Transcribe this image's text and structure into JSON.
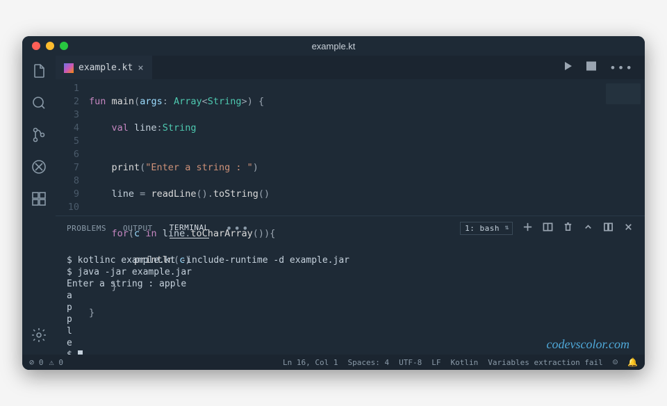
{
  "window": {
    "title": "example.kt"
  },
  "tab": {
    "filename": "example.kt"
  },
  "editor": {
    "gutter": [
      "1",
      "2",
      "3",
      "4",
      "5",
      "6",
      "7",
      "8",
      "9",
      "10"
    ],
    "l1": {
      "kw1": "fun",
      "fn": "main",
      "p1": "(",
      "arg": "args",
      "colon": ":",
      "sp": " ",
      "type1": "Array",
      "lt": "<",
      "type2": "String",
      "gt": ">",
      "p2": ")",
      "sp2": " ",
      "brace": "{"
    },
    "l2": {
      "indent": "    ",
      "kw": "val",
      "name": " line",
      "colon": ":",
      "type": "String"
    },
    "l3": "",
    "l4": {
      "indent": "    ",
      "fn": "print",
      "p1": "(",
      "str": "\"Enter a string : \"",
      "p2": ")"
    },
    "l5": {
      "indent": "    ",
      "lhs": "line ",
      "eq": "=",
      "sp": " ",
      "fn1": "readLine",
      "p1": "()",
      "dot": ".",
      "fn2": "toString",
      "p2": "()"
    },
    "l6": "",
    "l7": {
      "indent": "    ",
      "kw1": "for",
      "p1": "(",
      "v": "c",
      "sp1": " ",
      "kw2": "in",
      "sp2": " ",
      "obj": "line",
      "dot": ".",
      "fn": "toCharArray",
      "p2": "()",
      "p3": ")",
      "brace": "{"
    },
    "l8": {
      "indent": "        ",
      "fn": "println",
      "p1": "(",
      "v": "c",
      "p2": ")"
    },
    "l9": {
      "indent": "    ",
      "brace": "}"
    },
    "l10": {
      "brace": "}"
    }
  },
  "panel": {
    "tabs": {
      "problems": "PROBLEMS",
      "output": "OUTPUT",
      "terminal": "TERMINAL"
    },
    "more": "•••",
    "selector": "1: bash"
  },
  "terminal": {
    "lines": [
      "$ kotlinc example.kt -include-runtime -d example.jar",
      "$ java -jar example.jar",
      "Enter a string : apple",
      "a",
      "p",
      "p",
      "l",
      "e",
      "$ "
    ]
  },
  "watermark": "codevscolor.com",
  "statusbar": {
    "errors": "0",
    "warnings": "0",
    "lncol": "Ln 16, Col 1",
    "spaces": "Spaces: 4",
    "encoding": "UTF-8",
    "eol": "LF",
    "language": "Kotlin",
    "extra": "Variables extraction fail"
  }
}
